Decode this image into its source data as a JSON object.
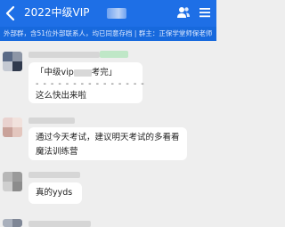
{
  "header": {
    "back_icon": "chevron-left-icon",
    "title": "2022中级VIP",
    "members_icon": "group-members-icon",
    "menu_icon": "menu-icon"
  },
  "notice": {
    "text": "外部群，含51位外部联系人，均已同意存档 | 群主：正保学堂师保老师"
  },
  "messages": [
    {
      "sender_badge_hint": "微信",
      "quote": "「中级vip",
      "quote_tail": "考完」",
      "separator": "- - - - - - - - - - - - - - -",
      "text": "这么快出来啦"
    },
    {
      "text_line1": "通过今天考试，建议明天考试的多看看",
      "text_line2": "魔法训练营"
    },
    {
      "text": "真的yyds"
    }
  ],
  "colors": {
    "header_bg": "#1e6fe6",
    "notice_bg": "#1769dd",
    "chat_bg": "#eeeeee",
    "bubble_bg": "#ffffff",
    "wechat_badge": "#2bb34b"
  }
}
